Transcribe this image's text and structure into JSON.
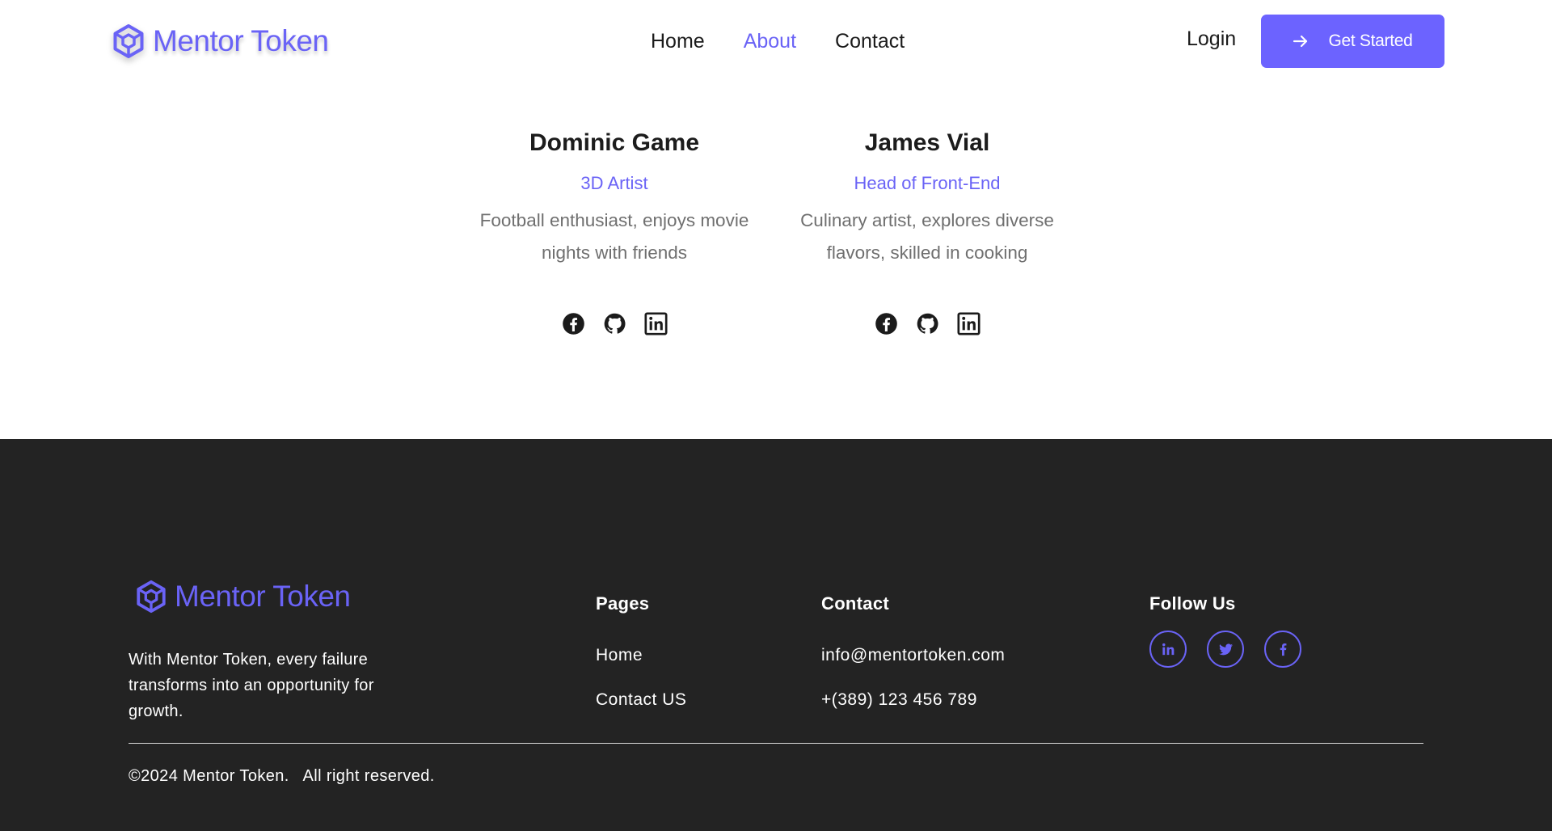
{
  "header": {
    "logo_text": "Mentor Token",
    "nav": [
      "Home",
      "About",
      "Contact"
    ],
    "active_nav": "About",
    "login_label": "Login",
    "cta_label": "Get Started"
  },
  "team": [
    {
      "name": "Dominic Game",
      "role": "3D Artist",
      "bio_line1": "Football enthusiast, enjoys movie",
      "bio_line2": "nights with friends",
      "socials": [
        "facebook-icon",
        "github-icon",
        "linkedin-icon"
      ]
    },
    {
      "name": "James Vial",
      "role": "Head of Front-End",
      "bio_line1": "Culinary artist, explores diverse",
      "bio_line2": "flavors, skilled in cooking",
      "socials": [
        "facebook-icon",
        "github-icon",
        "linkedin-icon"
      ]
    }
  ],
  "footer": {
    "logo_text": "Mentor Token",
    "tagline": "With Mentor Token, every failure transforms into an opportunity for growth.",
    "pages_title": "Pages",
    "pages_links": [
      "Home",
      "Contact US"
    ],
    "contact_title": "Contact",
    "contact_email": "info@mentortoken.com",
    "contact_phone": "+(389) 123 456 789",
    "follow_title": "Follow Us",
    "follow_icons": [
      "linkedin-icon",
      "twitter-icon",
      "facebook-icon"
    ],
    "copyright": "©2024 Mentor Token.   All right reserved."
  },
  "colors": {
    "accent": "#6a63f6",
    "button": "#6c63ff",
    "footer_bg": "#232323",
    "text_dark": "#1b1b1b",
    "text_muted": "#6f6f6f"
  }
}
